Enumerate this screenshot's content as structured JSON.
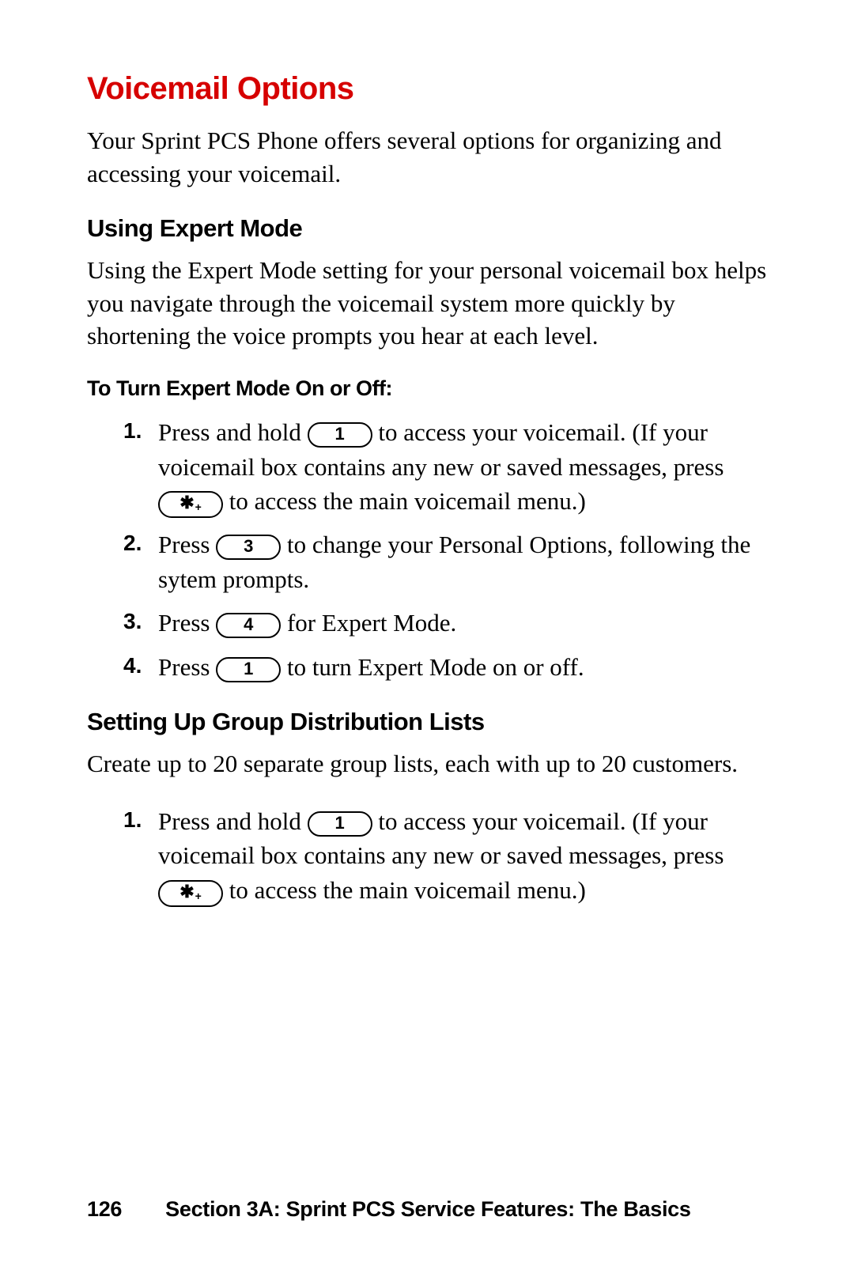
{
  "title": "Voicemail Options",
  "intro": "Your Sprint PCS Phone offers several options for organizing and accessing your voicemail.",
  "section1": {
    "heading": "Using Expert Mode",
    "body": "Using the Expert Mode setting for your personal voicemail box helps you navigate through the voicemail system more quickly by shortening the voice prompts you hear at each level.",
    "sub": "To Turn Expert Mode On or Off:",
    "steps": [
      {
        "num": "1.",
        "pre": "Press and hold ",
        "key1": "1",
        "mid": " to access your voicemail. (If your voicemail box contains any new or saved messages, press ",
        "key2": "✱",
        "key2sub": "+",
        "post": " to access the main voicemail menu.)"
      },
      {
        "num": "2.",
        "pre": "Press ",
        "key1": "3",
        "post": " to change your Personal Options, following the sytem prompts."
      },
      {
        "num": "3.",
        "pre": "Press ",
        "key1": "4",
        "post": " for Expert Mode."
      },
      {
        "num": "4.",
        "pre": "Press ",
        "key1": "1",
        "post": " to turn Expert Mode on or off."
      }
    ]
  },
  "section2": {
    "heading": "Setting Up Group Distribution Lists",
    "body": "Create up to 20 separate group lists, each with up to 20 customers.",
    "steps": [
      {
        "num": "1.",
        "pre": "Press and hold ",
        "key1": "1",
        "mid": " to access your voicemail. (If your voicemail box contains any new or saved messages, press ",
        "key2": "✱",
        "key2sub": "+",
        "post": " to access the main voicemail menu.)"
      }
    ]
  },
  "footer": {
    "page": "126",
    "text": "Section 3A: Sprint PCS Service Features: The Basics"
  }
}
